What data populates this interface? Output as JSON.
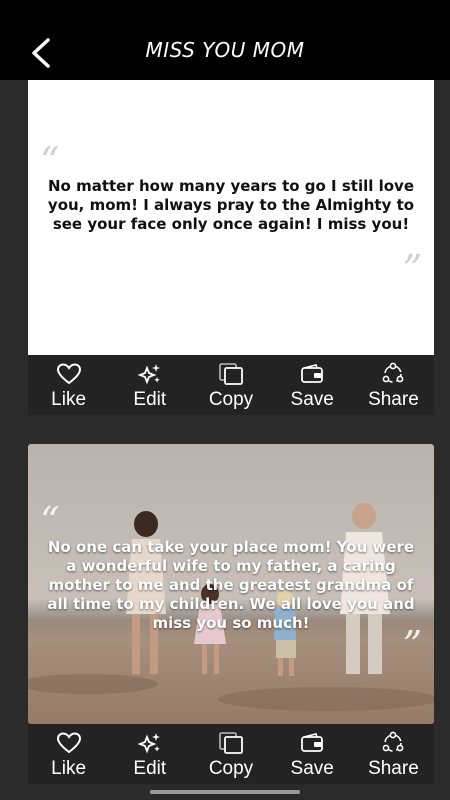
{
  "header": {
    "title": "MISS YOU MOM",
    "back_icon": "arrow-left-icon"
  },
  "cards": [
    {
      "quote": "No matter how many years to go I still love you, mom! I always pray to the Almighty to see your face only once again! I miss you!",
      "background": "white",
      "actions": [
        {
          "label": "Like",
          "icon": "heart-icon"
        },
        {
          "label": "Edit",
          "icon": "sparkles-icon"
        },
        {
          "label": "Copy",
          "icon": "copy-icon"
        },
        {
          "label": "Save",
          "icon": "wallet-icon"
        },
        {
          "label": "Share",
          "icon": "share-icon"
        }
      ]
    },
    {
      "quote": "No one can take your place mom! You were a wonderful wife to my father, a caring mother to me and the greatest grandma of all time to my children. We all love you and miss you so much!",
      "background": "family-beach-photo",
      "actions": [
        {
          "label": "Like",
          "icon": "heart-icon"
        },
        {
          "label": "Edit",
          "icon": "sparkles-icon"
        },
        {
          "label": "Copy",
          "icon": "copy-icon"
        },
        {
          "label": "Save",
          "icon": "wallet-icon"
        },
        {
          "label": "Share",
          "icon": "share-icon"
        }
      ]
    }
  ],
  "colors": {
    "topbar": "#000000",
    "background": "#2b2b2b",
    "action_bar": "#232323",
    "text_light": "#ffffff"
  }
}
